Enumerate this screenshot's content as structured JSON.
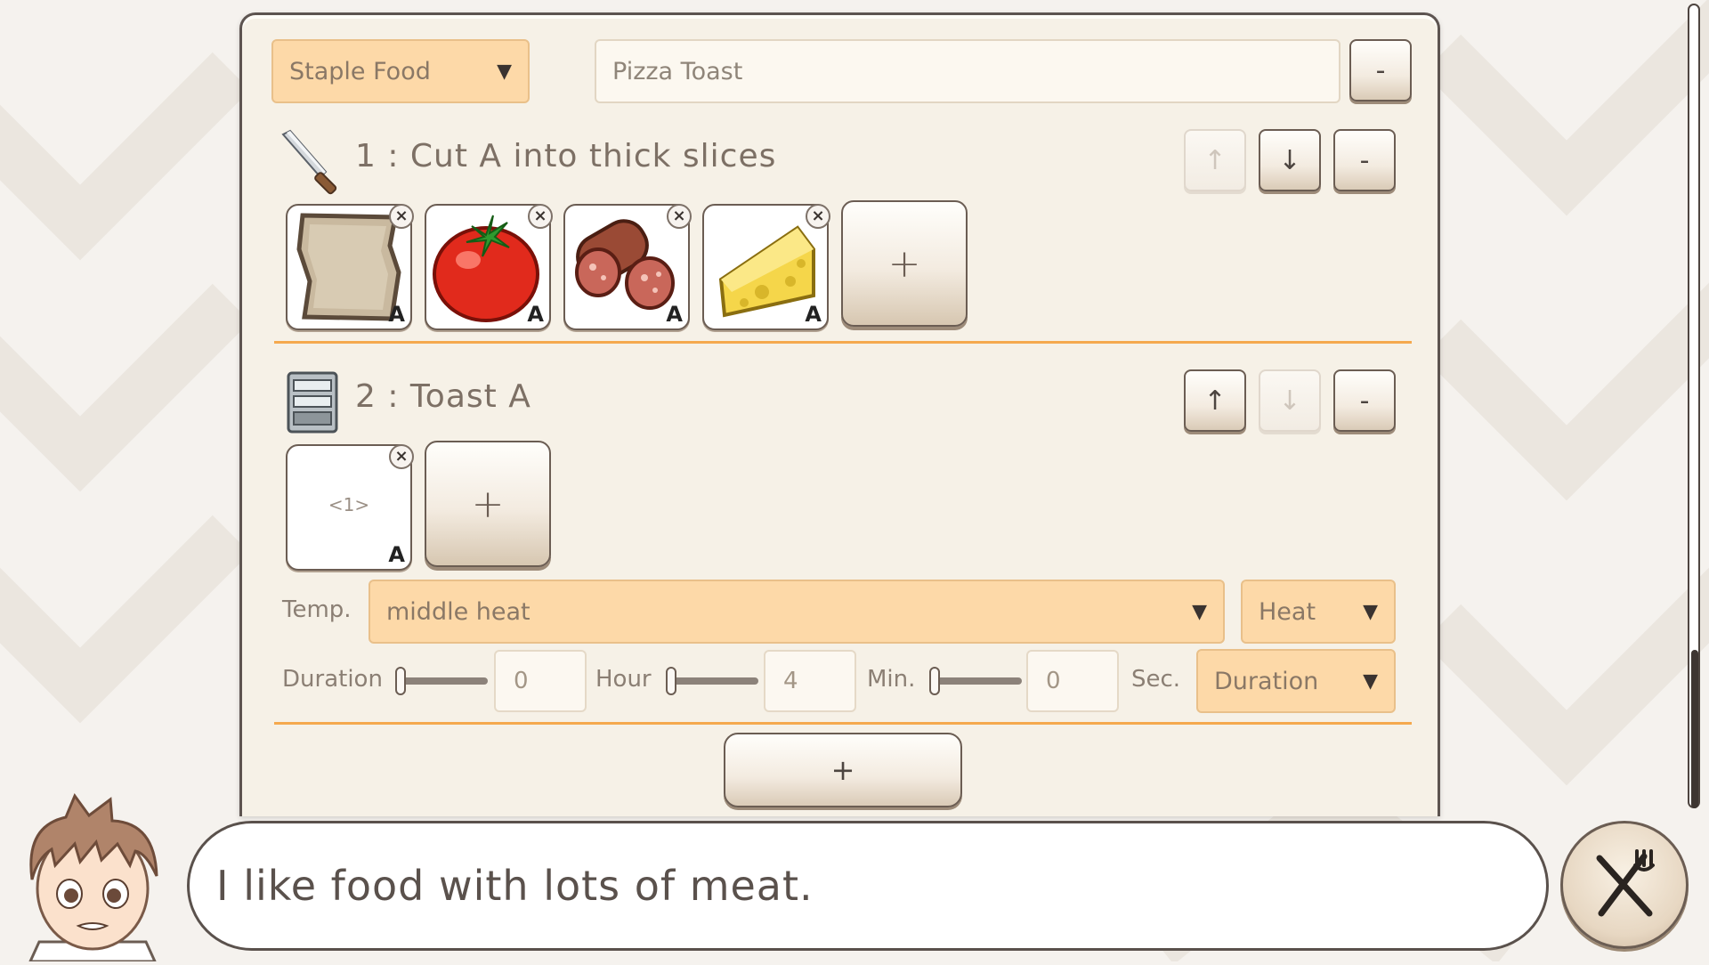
{
  "recipe": {
    "category": "Staple Food",
    "name_value": "Pizza Toast",
    "remove_label": "-"
  },
  "steps": [
    {
      "title": "1 : Cut A into thick slices",
      "tool_icon": "knife-icon",
      "up_label": "↑",
      "down_label": "↓",
      "remove_label": "-",
      "ingredients": [
        {
          "icon": "bread-slice-icon",
          "tag": "A",
          "close": "×"
        },
        {
          "icon": "tomato-icon",
          "tag": "A",
          "close": "×"
        },
        {
          "icon": "salami-icon",
          "tag": "A",
          "close": "×"
        },
        {
          "icon": "cheese-icon",
          "tag": "A",
          "close": "×"
        }
      ],
      "add_label": "+"
    },
    {
      "title": "2 : Toast A",
      "tool_icon": "toaster-oven-icon",
      "up_label": "↑",
      "down_label": "↓",
      "remove_label": "-",
      "ingredients": [
        {
          "ref": "<1>",
          "tag": "A",
          "close": "×"
        }
      ],
      "add_label": "+",
      "temp_label": "Temp.",
      "temp_value": "middle heat",
      "heat_mode": "Heat",
      "duration_label": "Duration",
      "hour_value": "0",
      "hour_label": "Hour",
      "min_value": "4",
      "min_label": "Min.",
      "sec_value": "0",
      "sec_label": "Sec.",
      "duration_mode": "Duration"
    }
  ],
  "add_step_label": "+",
  "dialogue": {
    "text": "I like food with lots of meat.",
    "avatar_icon": "boy-avatar"
  },
  "serve_button_icon": "fork-knife-icon",
  "colors": {
    "accent_orange": "#f5a94e",
    "dropdown_fill": "#fdd9a8",
    "panel_bg": "#f6f1e7",
    "border_dark": "#5d5450"
  }
}
